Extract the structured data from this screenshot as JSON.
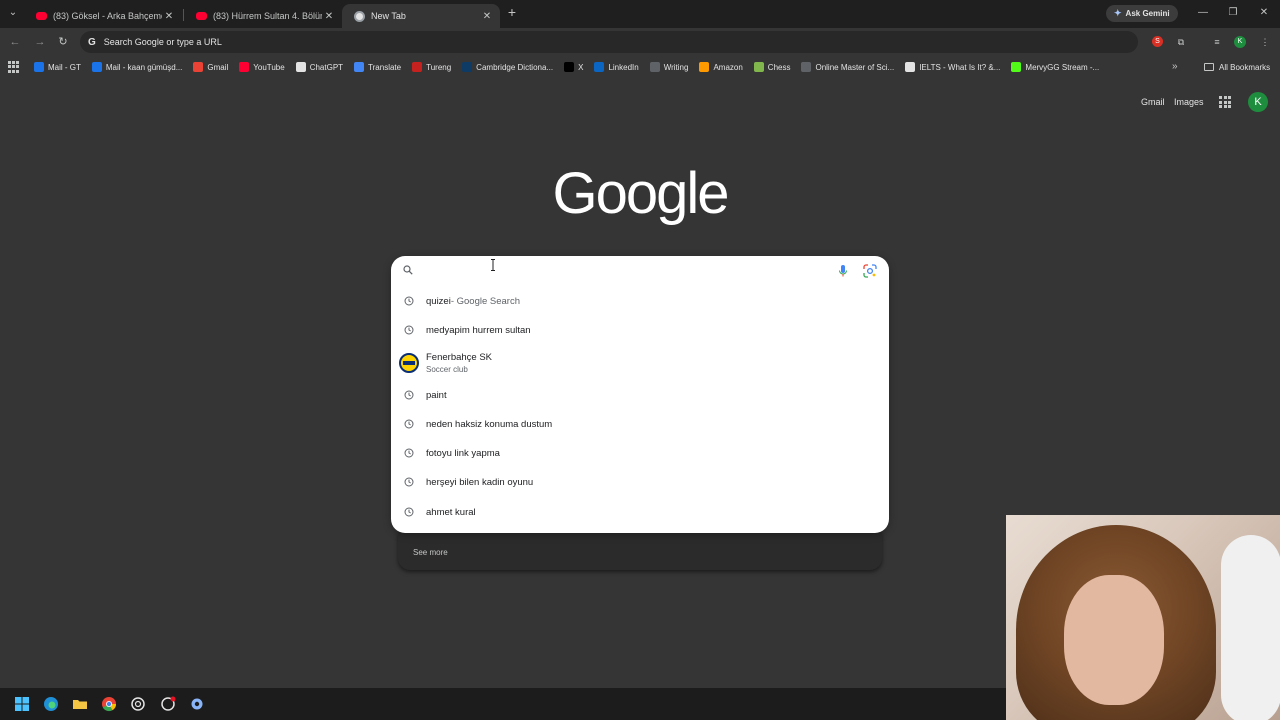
{
  "tabs": [
    {
      "title": "(83) Göksel - Arka Bahçemde -",
      "favicon": "youtube-icon"
    },
    {
      "title": "(83) Hürrem Sultan 4. Bölüm - \\",
      "favicon": "youtube-icon"
    },
    {
      "title": "New Tab",
      "favicon": "chrome-icon",
      "active": true
    }
  ],
  "ask_gemini": "Ask Gemini",
  "omnibox": {
    "placeholder": "Search Google or type a URL",
    "avatar_letter": "K"
  },
  "bookmarks": [
    {
      "label": "Mail - GT",
      "icon": "#1a73e8"
    },
    {
      "label": "Mail - kaan gümüşd...",
      "icon": "#1a73e8"
    },
    {
      "label": "Gmail",
      "icon": "#ea4335"
    },
    {
      "label": "YouTube",
      "icon": "#ff0033"
    },
    {
      "label": "ChatGPT",
      "icon": "#e3e3e3"
    },
    {
      "label": "Translate",
      "icon": "#4285f4"
    },
    {
      "label": "Tureng",
      "icon": "#c5221f"
    },
    {
      "label": "Cambridge Dictiona...",
      "icon": "#0d3b66"
    },
    {
      "label": "X",
      "icon": "#000000"
    },
    {
      "label": "LinkedIn",
      "icon": "#0a66c2"
    },
    {
      "label": "Writing",
      "icon": "#5f6368"
    },
    {
      "label": "Amazon",
      "icon": "#ff9900"
    },
    {
      "label": "Chess",
      "icon": "#81b64c"
    },
    {
      "label": "Online Master of Sci...",
      "icon": "#5f6368"
    },
    {
      "label": "IELTS - What Is It? &...",
      "icon": "#e3e3e3"
    },
    {
      "label": "MervyGG Stream -...",
      "icon": "#53fc18"
    }
  ],
  "all_bookmarks": "All Bookmarks",
  "ntp": {
    "gmail": "Gmail",
    "images": "Images",
    "avatar_letter": "K",
    "logo": "Google"
  },
  "search": {
    "value": "",
    "placeholder": ""
  },
  "suggestions": [
    {
      "type": "history",
      "text": "quizei",
      "suffix": " - Google Search"
    },
    {
      "type": "history",
      "text": "medyapim hurrem sultan"
    },
    {
      "type": "entity",
      "text": "Fenerbahçe SK",
      "subtitle": "Soccer club"
    },
    {
      "type": "history",
      "text": "paint"
    },
    {
      "type": "history",
      "text": "neden haksiz konuma dustum"
    },
    {
      "type": "history",
      "text": "fotoyu link yapma"
    },
    {
      "type": "history",
      "text": "herşeyi bilen kadin oyunu"
    },
    {
      "type": "history",
      "text": "ahmet kural"
    }
  ],
  "see_more": "See more",
  "colors": {
    "background": "#353535",
    "tabstrip": "#1f1f1f",
    "dropdown": "#ffffff",
    "accent_avatar": "#1e8e3e"
  }
}
